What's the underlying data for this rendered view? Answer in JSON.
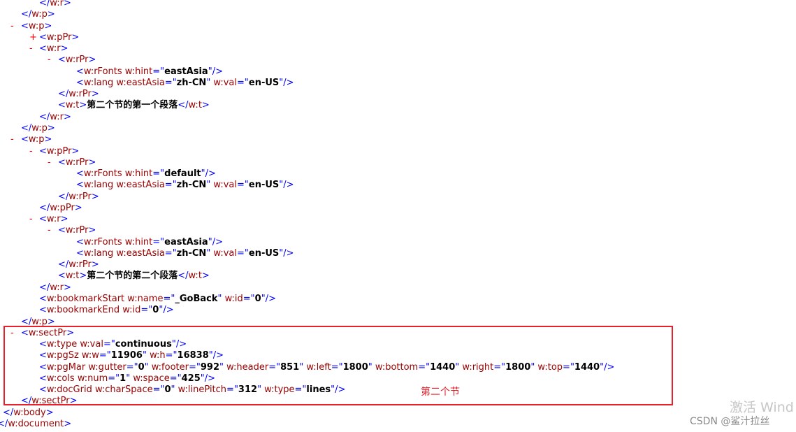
{
  "lines": [
    {
      "indent": 56,
      "tokens": [
        {
          "k": "p",
          "s": "</"
        },
        {
          "k": "e",
          "s": "w:r"
        },
        {
          "k": "p",
          "s": ">"
        }
      ]
    },
    {
      "indent": 30,
      "tokens": [
        {
          "k": "p",
          "s": "</"
        },
        {
          "k": "e",
          "s": "w:p"
        },
        {
          "k": "p",
          "s": ">"
        }
      ]
    },
    {
      "indent": 30,
      "marker": {
        "sym": "-",
        "x": 15
      },
      "tokens": [
        {
          "k": "p",
          "s": "<"
        },
        {
          "k": "e",
          "s": "w:p"
        },
        {
          "k": "p",
          "s": ">"
        }
      ]
    },
    {
      "indent": 56,
      "marker": {
        "sym": "+",
        "x": 42
      },
      "tokens": [
        {
          "k": "p",
          "s": "<"
        },
        {
          "k": "e",
          "s": "w:pPr"
        },
        {
          "k": "p",
          "s": ">"
        }
      ]
    },
    {
      "indent": 56,
      "marker": {
        "sym": "-",
        "x": 42
      },
      "tokens": [
        {
          "k": "p",
          "s": "<"
        },
        {
          "k": "e",
          "s": "w:r"
        },
        {
          "k": "p",
          "s": ">"
        }
      ]
    },
    {
      "indent": 83,
      "marker": {
        "sym": "-",
        "x": 68
      },
      "tokens": [
        {
          "k": "p",
          "s": "<"
        },
        {
          "k": "e",
          "s": "w:rPr"
        },
        {
          "k": "p",
          "s": ">"
        }
      ]
    },
    {
      "indent": 109,
      "tokens": [
        {
          "k": "p",
          "s": "<"
        },
        {
          "k": "e",
          "s": "w:rFonts"
        },
        {
          "k": "a",
          "s": " w:hint"
        },
        {
          "k": "p",
          "s": "=\""
        },
        {
          "k": "v",
          "s": "eastAsia"
        },
        {
          "k": "p",
          "s": "\"/>"
        }
      ]
    },
    {
      "indent": 109,
      "tokens": [
        {
          "k": "p",
          "s": "<"
        },
        {
          "k": "e",
          "s": "w:lang"
        },
        {
          "k": "a",
          "s": " w:eastAsia"
        },
        {
          "k": "p",
          "s": "=\""
        },
        {
          "k": "v",
          "s": "zh-CN"
        },
        {
          "k": "p",
          "s": "\""
        },
        {
          "k": "a",
          "s": " w:val"
        },
        {
          "k": "p",
          "s": "=\""
        },
        {
          "k": "v",
          "s": "en-US"
        },
        {
          "k": "p",
          "s": "\"/>"
        }
      ]
    },
    {
      "indent": 83,
      "tokens": [
        {
          "k": "p",
          "s": "</"
        },
        {
          "k": "e",
          "s": "w:rPr"
        },
        {
          "k": "p",
          "s": ">"
        }
      ]
    },
    {
      "indent": 83,
      "tokens": [
        {
          "k": "p",
          "s": "<"
        },
        {
          "k": "e",
          "s": "w:t"
        },
        {
          "k": "p",
          "s": ">"
        },
        {
          "k": "t",
          "s": "第二个节的第一个段落"
        },
        {
          "k": "p",
          "s": "</"
        },
        {
          "k": "e",
          "s": "w:t"
        },
        {
          "k": "p",
          "s": ">"
        }
      ]
    },
    {
      "indent": 56,
      "tokens": [
        {
          "k": "p",
          "s": "</"
        },
        {
          "k": "e",
          "s": "w:r"
        },
        {
          "k": "p",
          "s": ">"
        }
      ]
    },
    {
      "indent": 30,
      "tokens": [
        {
          "k": "p",
          "s": "</"
        },
        {
          "k": "e",
          "s": "w:p"
        },
        {
          "k": "p",
          "s": ">"
        }
      ]
    },
    {
      "indent": 30,
      "marker": {
        "sym": "-",
        "x": 15
      },
      "tokens": [
        {
          "k": "p",
          "s": "<"
        },
        {
          "k": "e",
          "s": "w:p"
        },
        {
          "k": "p",
          "s": ">"
        }
      ]
    },
    {
      "indent": 56,
      "marker": {
        "sym": "-",
        "x": 42
      },
      "tokens": [
        {
          "k": "p",
          "s": "<"
        },
        {
          "k": "e",
          "s": "w:pPr"
        },
        {
          "k": "p",
          "s": ">"
        }
      ]
    },
    {
      "indent": 83,
      "marker": {
        "sym": "-",
        "x": 68
      },
      "tokens": [
        {
          "k": "p",
          "s": "<"
        },
        {
          "k": "e",
          "s": "w:rPr"
        },
        {
          "k": "p",
          "s": ">"
        }
      ]
    },
    {
      "indent": 109,
      "tokens": [
        {
          "k": "p",
          "s": "<"
        },
        {
          "k": "e",
          "s": "w:rFonts"
        },
        {
          "k": "a",
          "s": " w:hint"
        },
        {
          "k": "p",
          "s": "=\""
        },
        {
          "k": "v",
          "s": "default"
        },
        {
          "k": "p",
          "s": "\"/>"
        }
      ]
    },
    {
      "indent": 109,
      "tokens": [
        {
          "k": "p",
          "s": "<"
        },
        {
          "k": "e",
          "s": "w:lang"
        },
        {
          "k": "a",
          "s": " w:eastAsia"
        },
        {
          "k": "p",
          "s": "=\""
        },
        {
          "k": "v",
          "s": "zh-CN"
        },
        {
          "k": "p",
          "s": "\""
        },
        {
          "k": "a",
          "s": " w:val"
        },
        {
          "k": "p",
          "s": "=\""
        },
        {
          "k": "v",
          "s": "en-US"
        },
        {
          "k": "p",
          "s": "\"/>"
        }
      ]
    },
    {
      "indent": 83,
      "tokens": [
        {
          "k": "p",
          "s": "</"
        },
        {
          "k": "e",
          "s": "w:rPr"
        },
        {
          "k": "p",
          "s": ">"
        }
      ]
    },
    {
      "indent": 56,
      "tokens": [
        {
          "k": "p",
          "s": "</"
        },
        {
          "k": "e",
          "s": "w:pPr"
        },
        {
          "k": "p",
          "s": ">"
        }
      ]
    },
    {
      "indent": 56,
      "marker": {
        "sym": "-",
        "x": 42
      },
      "tokens": [
        {
          "k": "p",
          "s": "<"
        },
        {
          "k": "e",
          "s": "w:r"
        },
        {
          "k": "p",
          "s": ">"
        }
      ]
    },
    {
      "indent": 83,
      "marker": {
        "sym": "-",
        "x": 68
      },
      "tokens": [
        {
          "k": "p",
          "s": "<"
        },
        {
          "k": "e",
          "s": "w:rPr"
        },
        {
          "k": "p",
          "s": ">"
        }
      ]
    },
    {
      "indent": 109,
      "tokens": [
        {
          "k": "p",
          "s": "<"
        },
        {
          "k": "e",
          "s": "w:rFonts"
        },
        {
          "k": "a",
          "s": " w:hint"
        },
        {
          "k": "p",
          "s": "=\""
        },
        {
          "k": "v",
          "s": "eastAsia"
        },
        {
          "k": "p",
          "s": "\"/>"
        }
      ]
    },
    {
      "indent": 109,
      "tokens": [
        {
          "k": "p",
          "s": "<"
        },
        {
          "k": "e",
          "s": "w:lang"
        },
        {
          "k": "a",
          "s": " w:eastAsia"
        },
        {
          "k": "p",
          "s": "=\""
        },
        {
          "k": "v",
          "s": "zh-CN"
        },
        {
          "k": "p",
          "s": "\""
        },
        {
          "k": "a",
          "s": " w:val"
        },
        {
          "k": "p",
          "s": "=\""
        },
        {
          "k": "v",
          "s": "en-US"
        },
        {
          "k": "p",
          "s": "\"/>"
        }
      ]
    },
    {
      "indent": 83,
      "tokens": [
        {
          "k": "p",
          "s": "</"
        },
        {
          "k": "e",
          "s": "w:rPr"
        },
        {
          "k": "p",
          "s": ">"
        }
      ]
    },
    {
      "indent": 83,
      "tokens": [
        {
          "k": "p",
          "s": "<"
        },
        {
          "k": "e",
          "s": "w:t"
        },
        {
          "k": "p",
          "s": ">"
        },
        {
          "k": "t",
          "s": "第二个节的第二个段落"
        },
        {
          "k": "p",
          "s": "</"
        },
        {
          "k": "e",
          "s": "w:t"
        },
        {
          "k": "p",
          "s": ">"
        }
      ]
    },
    {
      "indent": 56,
      "tokens": [
        {
          "k": "p",
          "s": "</"
        },
        {
          "k": "e",
          "s": "w:r"
        },
        {
          "k": "p",
          "s": ">"
        }
      ]
    },
    {
      "indent": 56,
      "tokens": [
        {
          "k": "p",
          "s": "<"
        },
        {
          "k": "e",
          "s": "w:bookmarkStart"
        },
        {
          "k": "a",
          "s": " w:name"
        },
        {
          "k": "p",
          "s": "=\""
        },
        {
          "k": "v",
          "s": "_GoBack"
        },
        {
          "k": "p",
          "s": "\""
        },
        {
          "k": "a",
          "s": " w:id"
        },
        {
          "k": "p",
          "s": "=\""
        },
        {
          "k": "v",
          "s": "0"
        },
        {
          "k": "p",
          "s": "\"/>"
        }
      ]
    },
    {
      "indent": 56,
      "tokens": [
        {
          "k": "p",
          "s": "<"
        },
        {
          "k": "e",
          "s": "w:bookmarkEnd"
        },
        {
          "k": "a",
          "s": " w:id"
        },
        {
          "k": "p",
          "s": "=\""
        },
        {
          "k": "v",
          "s": "0"
        },
        {
          "k": "p",
          "s": "\"/>"
        }
      ]
    },
    {
      "indent": 30,
      "tokens": [
        {
          "k": "p",
          "s": "</"
        },
        {
          "k": "e",
          "s": "w:p"
        },
        {
          "k": "p",
          "s": ">"
        }
      ]
    },
    {
      "indent": 30,
      "marker": {
        "sym": "-",
        "x": 15
      },
      "tokens": [
        {
          "k": "p",
          "s": "<"
        },
        {
          "k": "e",
          "s": "w:sectPr"
        },
        {
          "k": "p",
          "s": ">"
        }
      ]
    },
    {
      "indent": 56,
      "tokens": [
        {
          "k": "p",
          "s": "<"
        },
        {
          "k": "e",
          "s": "w:type"
        },
        {
          "k": "a",
          "s": " w:val"
        },
        {
          "k": "p",
          "s": "=\""
        },
        {
          "k": "v",
          "s": "continuous"
        },
        {
          "k": "p",
          "s": "\"/>"
        }
      ]
    },
    {
      "indent": 56,
      "tokens": [
        {
          "k": "p",
          "s": "<"
        },
        {
          "k": "e",
          "s": "w:pgSz"
        },
        {
          "k": "a",
          "s": " w:w"
        },
        {
          "k": "p",
          "s": "=\""
        },
        {
          "k": "v",
          "s": "11906"
        },
        {
          "k": "p",
          "s": "\""
        },
        {
          "k": "a",
          "s": " w:h"
        },
        {
          "k": "p",
          "s": "=\""
        },
        {
          "k": "v",
          "s": "16838"
        },
        {
          "k": "p",
          "s": "\"/>"
        }
      ]
    },
    {
      "indent": 56,
      "tokens": [
        {
          "k": "p",
          "s": "<"
        },
        {
          "k": "e",
          "s": "w:pgMar"
        },
        {
          "k": "a",
          "s": " w:gutter"
        },
        {
          "k": "p",
          "s": "=\""
        },
        {
          "k": "v",
          "s": "0"
        },
        {
          "k": "p",
          "s": "\""
        },
        {
          "k": "a",
          "s": " w:footer"
        },
        {
          "k": "p",
          "s": "=\""
        },
        {
          "k": "v",
          "s": "992"
        },
        {
          "k": "p",
          "s": "\""
        },
        {
          "k": "a",
          "s": " w:header"
        },
        {
          "k": "p",
          "s": "=\""
        },
        {
          "k": "v",
          "s": "851"
        },
        {
          "k": "p",
          "s": "\""
        },
        {
          "k": "a",
          "s": " w:left"
        },
        {
          "k": "p",
          "s": "=\""
        },
        {
          "k": "v",
          "s": "1800"
        },
        {
          "k": "p",
          "s": "\""
        },
        {
          "k": "a",
          "s": " w:bottom"
        },
        {
          "k": "p",
          "s": "=\""
        },
        {
          "k": "v",
          "s": "1440"
        },
        {
          "k": "p",
          "s": "\""
        },
        {
          "k": "a",
          "s": " w:right"
        },
        {
          "k": "p",
          "s": "=\""
        },
        {
          "k": "v",
          "s": "1800"
        },
        {
          "k": "p",
          "s": "\""
        },
        {
          "k": "a",
          "s": " w:top"
        },
        {
          "k": "p",
          "s": "=\""
        },
        {
          "k": "v",
          "s": "1440"
        },
        {
          "k": "p",
          "s": "\"/>"
        }
      ]
    },
    {
      "indent": 56,
      "tokens": [
        {
          "k": "p",
          "s": "<"
        },
        {
          "k": "e",
          "s": "w:cols"
        },
        {
          "k": "a",
          "s": " w:num"
        },
        {
          "k": "p",
          "s": "=\""
        },
        {
          "k": "v",
          "s": "1"
        },
        {
          "k": "p",
          "s": "\""
        },
        {
          "k": "a",
          "s": " w:space"
        },
        {
          "k": "p",
          "s": "=\""
        },
        {
          "k": "v",
          "s": "425"
        },
        {
          "k": "p",
          "s": "\"/>"
        }
      ]
    },
    {
      "indent": 56,
      "tokens": [
        {
          "k": "p",
          "s": "<"
        },
        {
          "k": "e",
          "s": "w:docGrid"
        },
        {
          "k": "a",
          "s": " w:charSpace"
        },
        {
          "k": "p",
          "s": "=\""
        },
        {
          "k": "v",
          "s": "0"
        },
        {
          "k": "p",
          "s": "\""
        },
        {
          "k": "a",
          "s": " w:linePitch"
        },
        {
          "k": "p",
          "s": "=\""
        },
        {
          "k": "v",
          "s": "312"
        },
        {
          "k": "p",
          "s": "\""
        },
        {
          "k": "a",
          "s": " w:type"
        },
        {
          "k": "p",
          "s": "=\""
        },
        {
          "k": "v",
          "s": "lines"
        },
        {
          "k": "p",
          "s": "\"/>"
        }
      ]
    },
    {
      "indent": 30,
      "tokens": [
        {
          "k": "p",
          "s": "</"
        },
        {
          "k": "e",
          "s": "w:sectPr"
        },
        {
          "k": "p",
          "s": ">"
        }
      ]
    },
    {
      "indent": 4,
      "tokens": [
        {
          "k": "p",
          "s": "</"
        },
        {
          "k": "e",
          "s": "w:body"
        },
        {
          "k": "p",
          "s": ">"
        }
      ]
    },
    {
      "indent": -4,
      "tokens": [
        {
          "k": "p",
          "s": "</"
        },
        {
          "k": "e",
          "s": "w:document"
        },
        {
          "k": "p",
          "s": ">"
        }
      ]
    }
  ],
  "annotation": {
    "label": "第二个节"
  },
  "watermarks": {
    "windows": "激活 Wind",
    "csdn": "CSDN @鲨汁拉丝"
  },
  "colors": {
    "punct": "#0000ff",
    "element": "#990000",
    "value": "#000000",
    "marker": "#ff0000",
    "highlight": "#e8202a"
  }
}
